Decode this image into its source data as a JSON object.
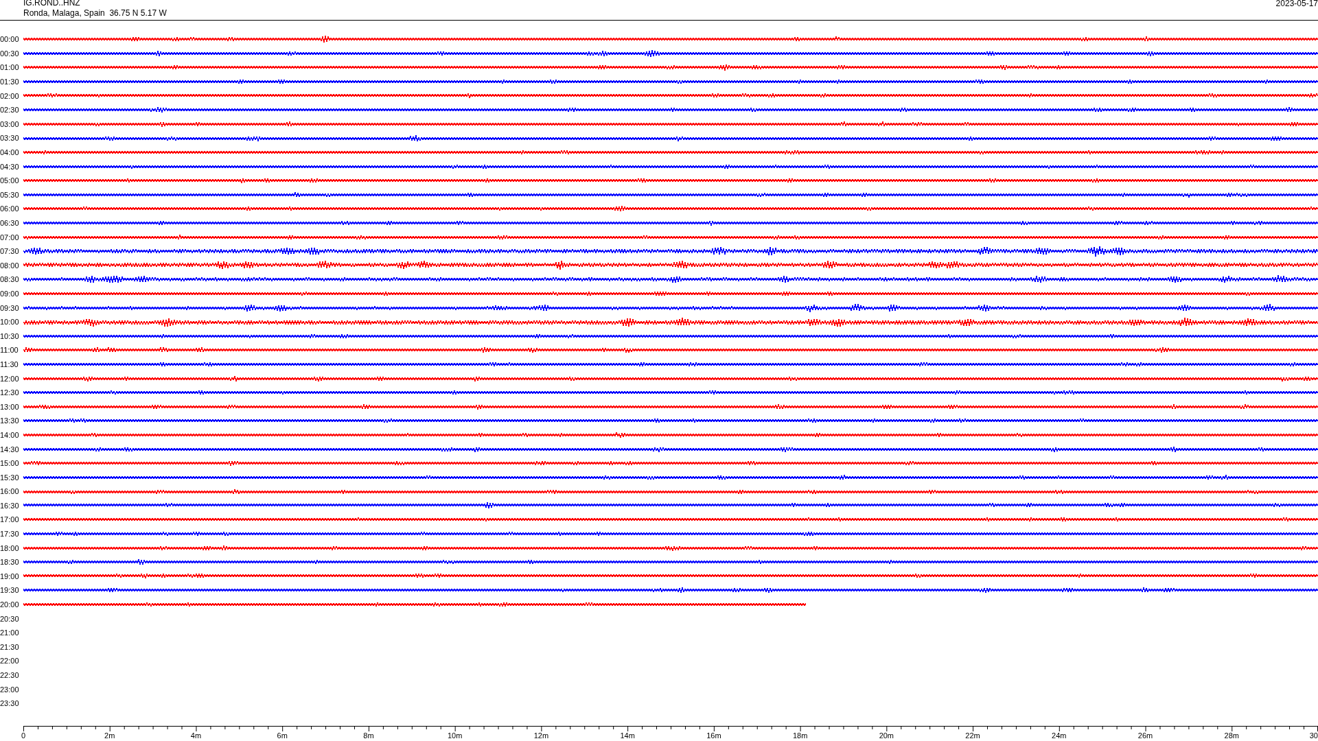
{
  "header": {
    "station": "IG.ROND..HNZ",
    "location": "Ronda, Malaga, Spain  36.75 N 5.17 W",
    "date": "2023-05-17"
  },
  "rows": [
    {
      "time": "00:00",
      "kind": "full",
      "color": "#ff0000"
    },
    {
      "time": "00:30",
      "kind": "full",
      "color": "#0000ff"
    },
    {
      "time": "01:00",
      "kind": "full",
      "color": "#ff0000"
    },
    {
      "time": "01:30",
      "kind": "full",
      "color": "#0000ff"
    },
    {
      "time": "02:00",
      "kind": "full",
      "color": "#ff0000"
    },
    {
      "time": "02:30",
      "kind": "full",
      "color": "#0000ff"
    },
    {
      "time": "03:00",
      "kind": "full",
      "color": "#ff0000"
    },
    {
      "time": "03:30",
      "kind": "full",
      "color": "#0000ff"
    },
    {
      "time": "04:00",
      "kind": "full",
      "color": "#ff0000"
    },
    {
      "time": "04:30",
      "kind": "full",
      "color": "#0000ff"
    },
    {
      "time": "05:00",
      "kind": "full",
      "color": "#ff0000"
    },
    {
      "time": "05:30",
      "kind": "full",
      "color": "#0000ff"
    },
    {
      "time": "06:00",
      "kind": "full",
      "color": "#ff0000"
    },
    {
      "time": "06:30",
      "kind": "full",
      "color": "#0000ff"
    },
    {
      "time": "07:00",
      "kind": "full",
      "color": "#ff0000"
    },
    {
      "time": "07:30",
      "kind": "full",
      "color": "#0000ff"
    },
    {
      "time": "08:00",
      "kind": "full",
      "color": "#ff0000"
    },
    {
      "time": "08:30",
      "kind": "full",
      "color": "#0000ff"
    },
    {
      "time": "09:00",
      "kind": "full",
      "color": "#ff0000"
    },
    {
      "time": "09:30",
      "kind": "full",
      "color": "#0000ff"
    },
    {
      "time": "10:00",
      "kind": "full",
      "color": "#ff0000"
    },
    {
      "time": "10:30",
      "kind": "full",
      "color": "#0000ff"
    },
    {
      "time": "11:00",
      "kind": "full",
      "color": "#ff0000"
    },
    {
      "time": "11:30",
      "kind": "full",
      "color": "#0000ff"
    },
    {
      "time": "12:00",
      "kind": "full",
      "color": "#ff0000"
    },
    {
      "time": "12:30",
      "kind": "full",
      "color": "#0000ff"
    },
    {
      "time": "13:00",
      "kind": "full",
      "color": "#ff0000"
    },
    {
      "time": "13:30",
      "kind": "full",
      "color": "#0000ff"
    },
    {
      "time": "14:00",
      "kind": "full",
      "color": "#ff0000"
    },
    {
      "time": "14:30",
      "kind": "full",
      "color": "#0000ff"
    },
    {
      "time": "15:00",
      "kind": "full",
      "color": "#ff0000"
    },
    {
      "time": "15:30",
      "kind": "full",
      "color": "#0000ff"
    },
    {
      "time": "16:00",
      "kind": "full",
      "color": "#ff0000"
    },
    {
      "time": "16:30",
      "kind": "full",
      "color": "#0000ff"
    },
    {
      "time": "17:00",
      "kind": "full",
      "color": "#ff0000"
    },
    {
      "time": "17:30",
      "kind": "full",
      "color": "#0000ff"
    },
    {
      "time": "18:00",
      "kind": "full",
      "color": "#ff0000"
    },
    {
      "time": "18:30",
      "kind": "full",
      "color": "#0000ff"
    },
    {
      "time": "19:00",
      "kind": "full",
      "color": "#ff0000"
    },
    {
      "time": "19:30",
      "kind": "full",
      "color": "#0000ff"
    },
    {
      "time": "20:00",
      "kind": "partial",
      "color": "#ff0000"
    },
    {
      "time": "20:30"
    },
    {
      "time": "21:00"
    },
    {
      "time": "21:30"
    },
    {
      "time": "22:00"
    },
    {
      "time": "22:30"
    },
    {
      "time": "23:00"
    },
    {
      "time": "23:30"
    }
  ],
  "time_axis": {
    "labels": [
      "0",
      "2m",
      "4m",
      "6m",
      "8m",
      "10m",
      "12m",
      "14m",
      "16m",
      "18m",
      "20m",
      "22m",
      "24m",
      "26m",
      "28m",
      "30"
    ]
  }
}
